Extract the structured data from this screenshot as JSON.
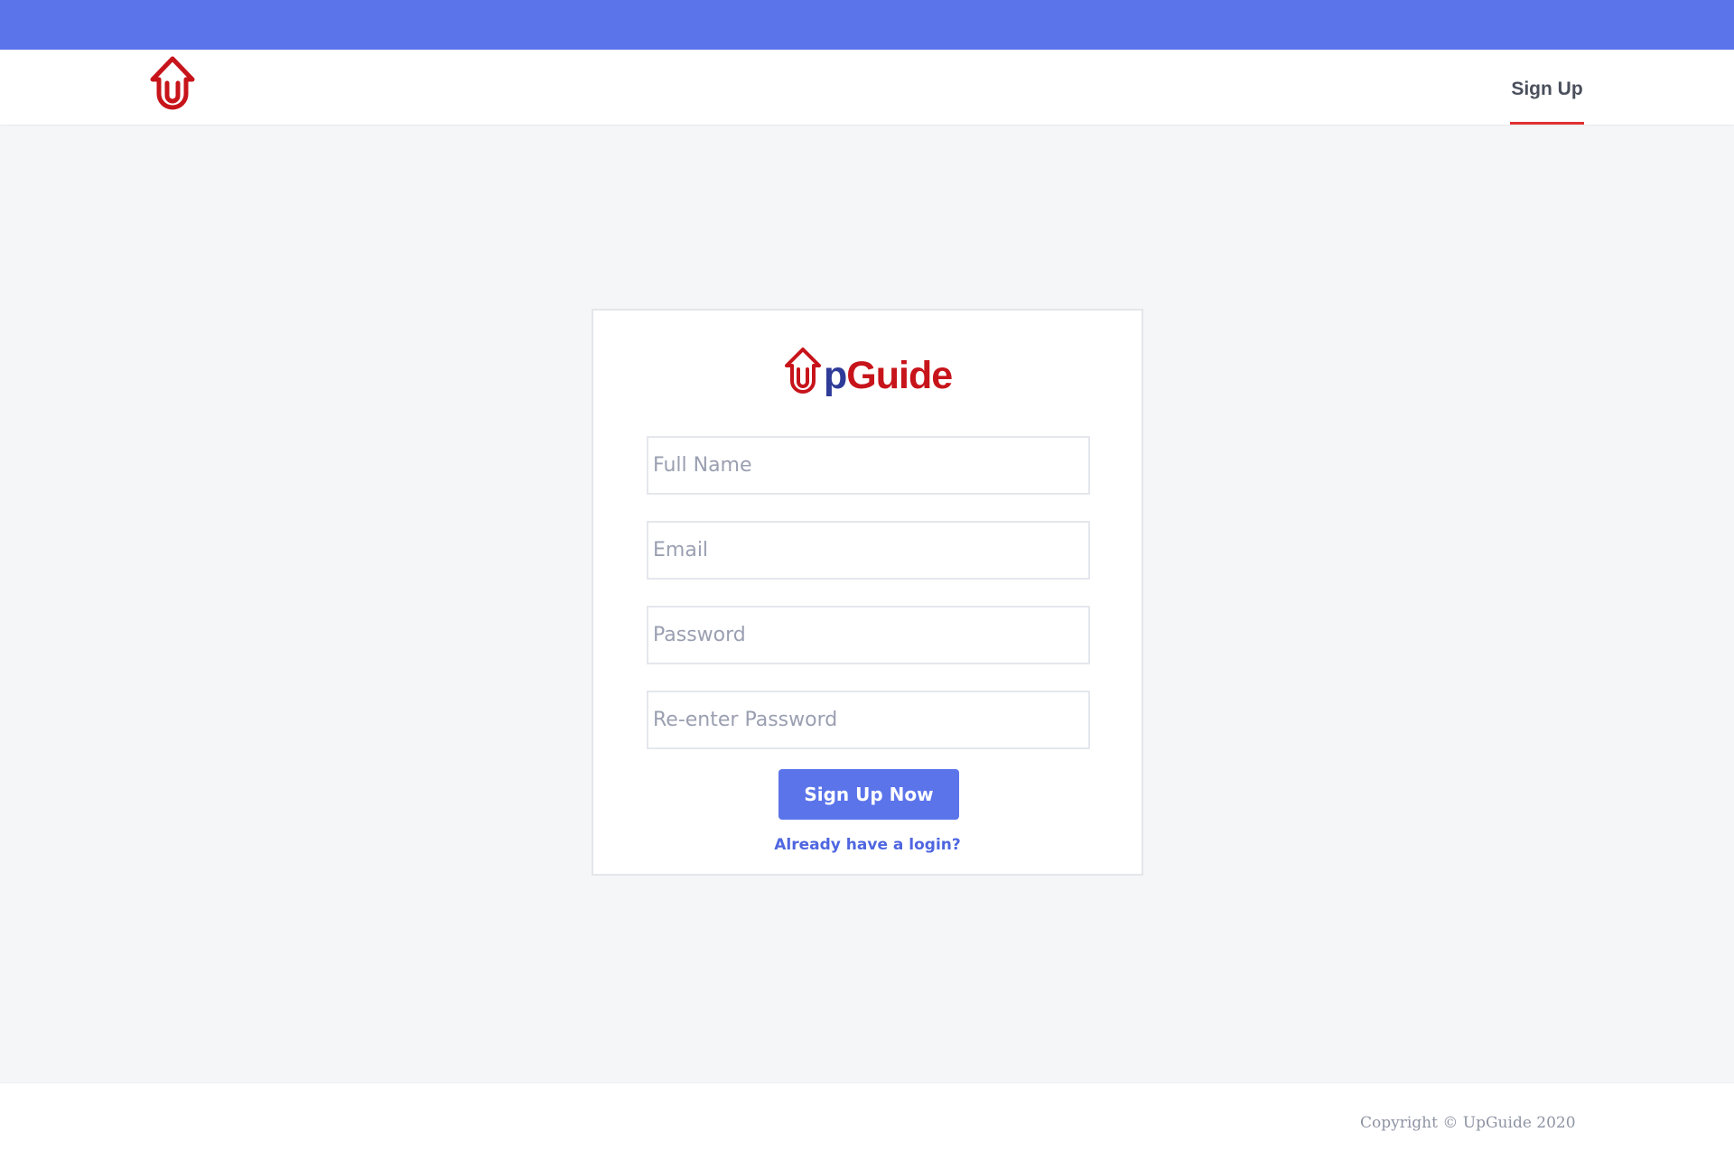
{
  "header": {
    "logo_icon": "upguide-arrow-u-icon",
    "nav_signup_label": "Sign Up"
  },
  "card": {
    "logo": {
      "part1": "p",
      "part2": "Guide"
    },
    "fields": {
      "full_name_placeholder": "Full Name",
      "email_placeholder": "Email",
      "password_placeholder": "Password",
      "reenter_password_placeholder": "Re-enter Password"
    },
    "submit_label": "Sign Up Now",
    "login_link_label": "Already have a login?"
  },
  "footer": {
    "copyright": "Copyright © UpGuide 2020"
  },
  "colors": {
    "accent": "#5b74ea",
    "brand_red": "#c7141b",
    "brand_blue": "#2f3b98",
    "tab_underline": "#e03131"
  }
}
